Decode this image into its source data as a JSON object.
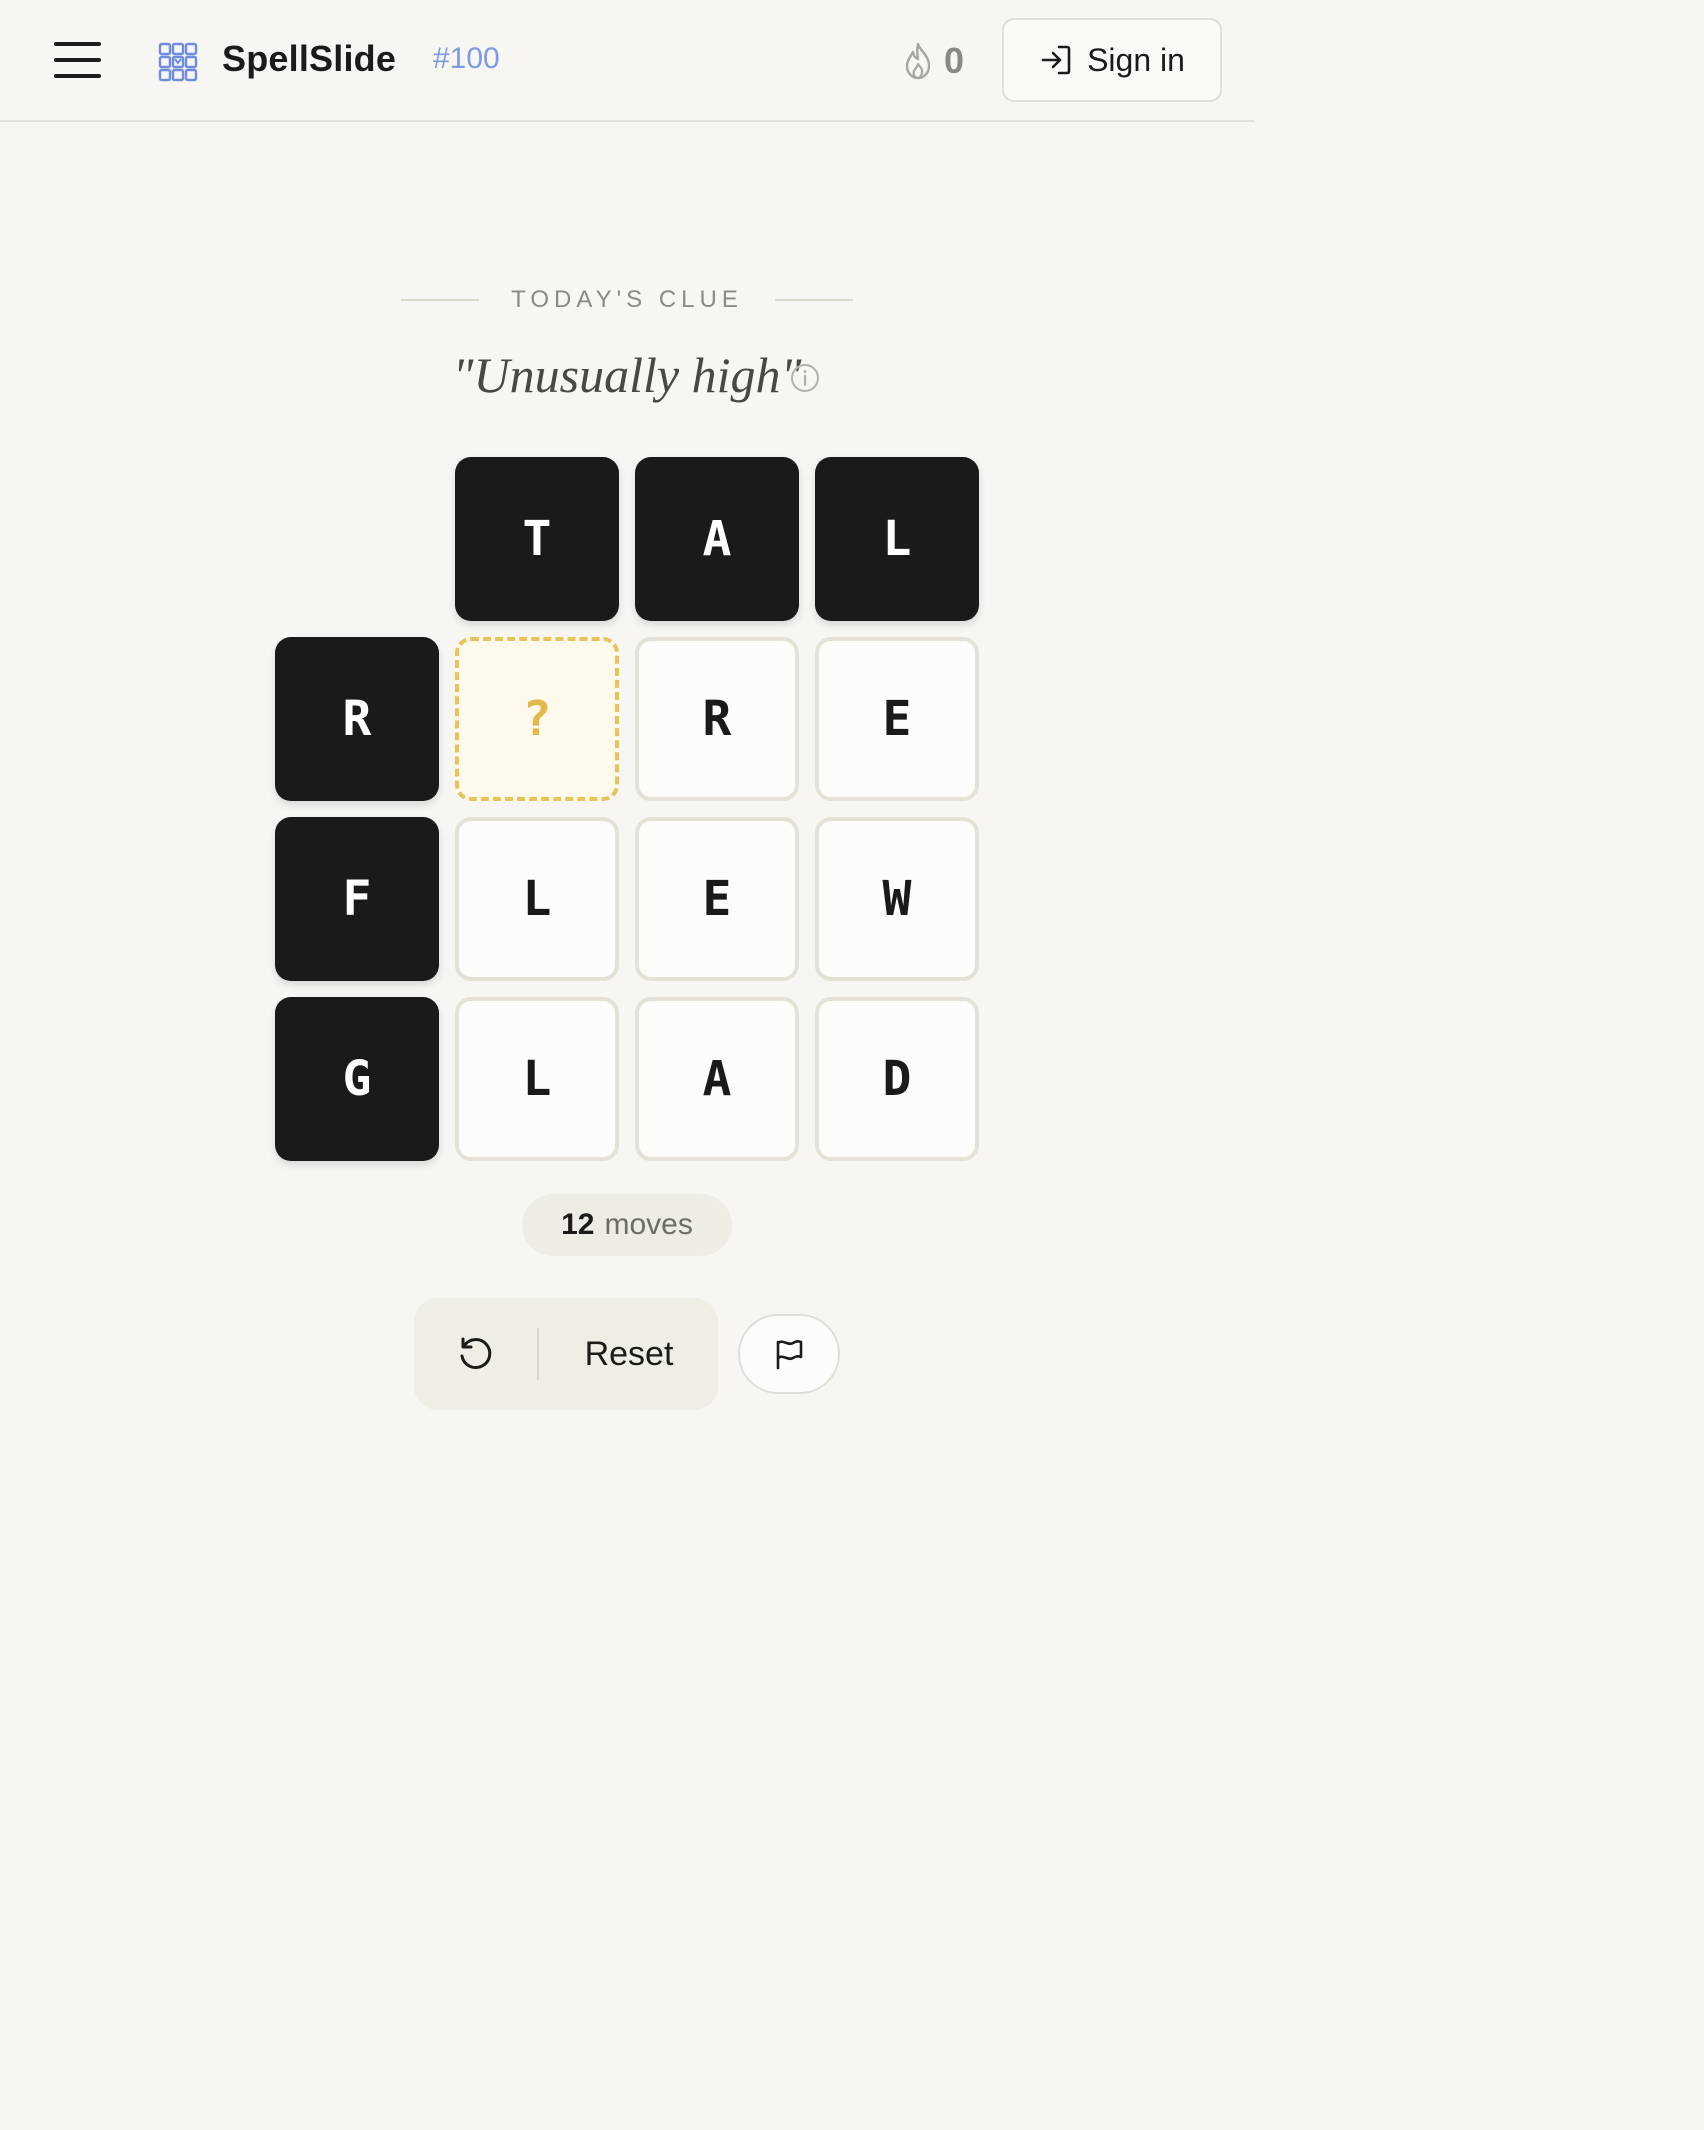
{
  "header": {
    "app_title": "SpellSlide",
    "puzzle_number": "#100",
    "streak_count": "0",
    "sign_in_label": "Sign in",
    "menu_icon": "hamburger-icon",
    "logo_icon": "grid-logo-icon",
    "streak_icon": "flame-icon",
    "sign_in_icon": "login-arrow-icon",
    "accent_color": "#7f99e3"
  },
  "clue": {
    "heading": "TODAY'S CLUE",
    "text": "\"Unusually high\"",
    "info_icon": "info-icon"
  },
  "board": {
    "rows": [
      [
        null,
        "T",
        "A",
        "L"
      ],
      [
        "R",
        "?",
        "R",
        "E"
      ],
      [
        "F",
        "L",
        "E",
        "W"
      ],
      [
        "G",
        "L",
        "A",
        "D"
      ]
    ],
    "tile_states": [
      [
        "none",
        "fixed",
        "fixed",
        "fixed"
      ],
      [
        "fixed",
        "empty",
        "movable",
        "movable"
      ],
      [
        "fixed",
        "movable",
        "movable",
        "movable"
      ],
      [
        "fixed",
        "movable",
        "movable",
        "movable"
      ]
    ],
    "colors": {
      "fixed": "#1b1a18",
      "movable": "#fdfcfa",
      "empty": "#e9c35a"
    }
  },
  "status": {
    "moves_count": "12",
    "moves_label": "moves"
  },
  "controls": {
    "undo_icon": "undo-icon",
    "reset_label": "Reset",
    "flag_icon": "flag-icon"
  }
}
